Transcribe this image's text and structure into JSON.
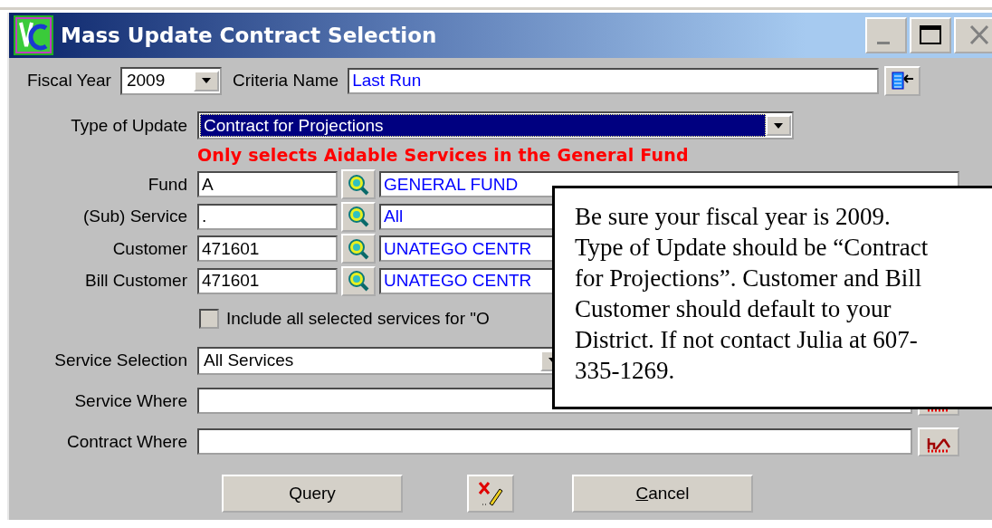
{
  "window": {
    "title": "Mass Update Contract Selection"
  },
  "fiscal_year": {
    "label": "Fiscal Year",
    "value": "2009"
  },
  "criteria_name": {
    "label": "Criteria Name",
    "value": "Last Run"
  },
  "type_of_update": {
    "label": "Type of Update",
    "value": "Contract for Projections",
    "selected": true
  },
  "warning": "Only selects Aidable Services in the General Fund",
  "lookups": [
    {
      "label": "Fund",
      "code": "A",
      "name": "GENERAL FUND"
    },
    {
      "label": "(Sub) Service",
      "code": ".",
      "name": "All"
    },
    {
      "label": "Customer",
      "code": "471601",
      "name": "UNATEGO CENTR"
    },
    {
      "label": "Bill Customer",
      "code": "471601",
      "name": "UNATEGO CENTR"
    }
  ],
  "include_option": {
    "label": "Include all selected services for \"O",
    "checked": false
  },
  "service_selection": {
    "label": "Service Selection",
    "value": "All Services"
  },
  "where_fields": [
    {
      "label": "Service Where"
    },
    {
      "label": "Contract Where"
    }
  ],
  "buttons": [
    {
      "kind": "text",
      "label": "Query",
      "mnemonic": false
    },
    {
      "kind": "icon"
    },
    {
      "kind": "text",
      "label": "Cancel",
      "mnemonic": true
    }
  ],
  "note": {
    "lines": [
      "Be sure your fiscal year is 2009.",
      "Type of Update should be “Contract",
      "for Projections”.  Customer and Bill",
      "Customer should default to your",
      "District.  If not contact Julia at 607-",
      "335-1269."
    ]
  }
}
